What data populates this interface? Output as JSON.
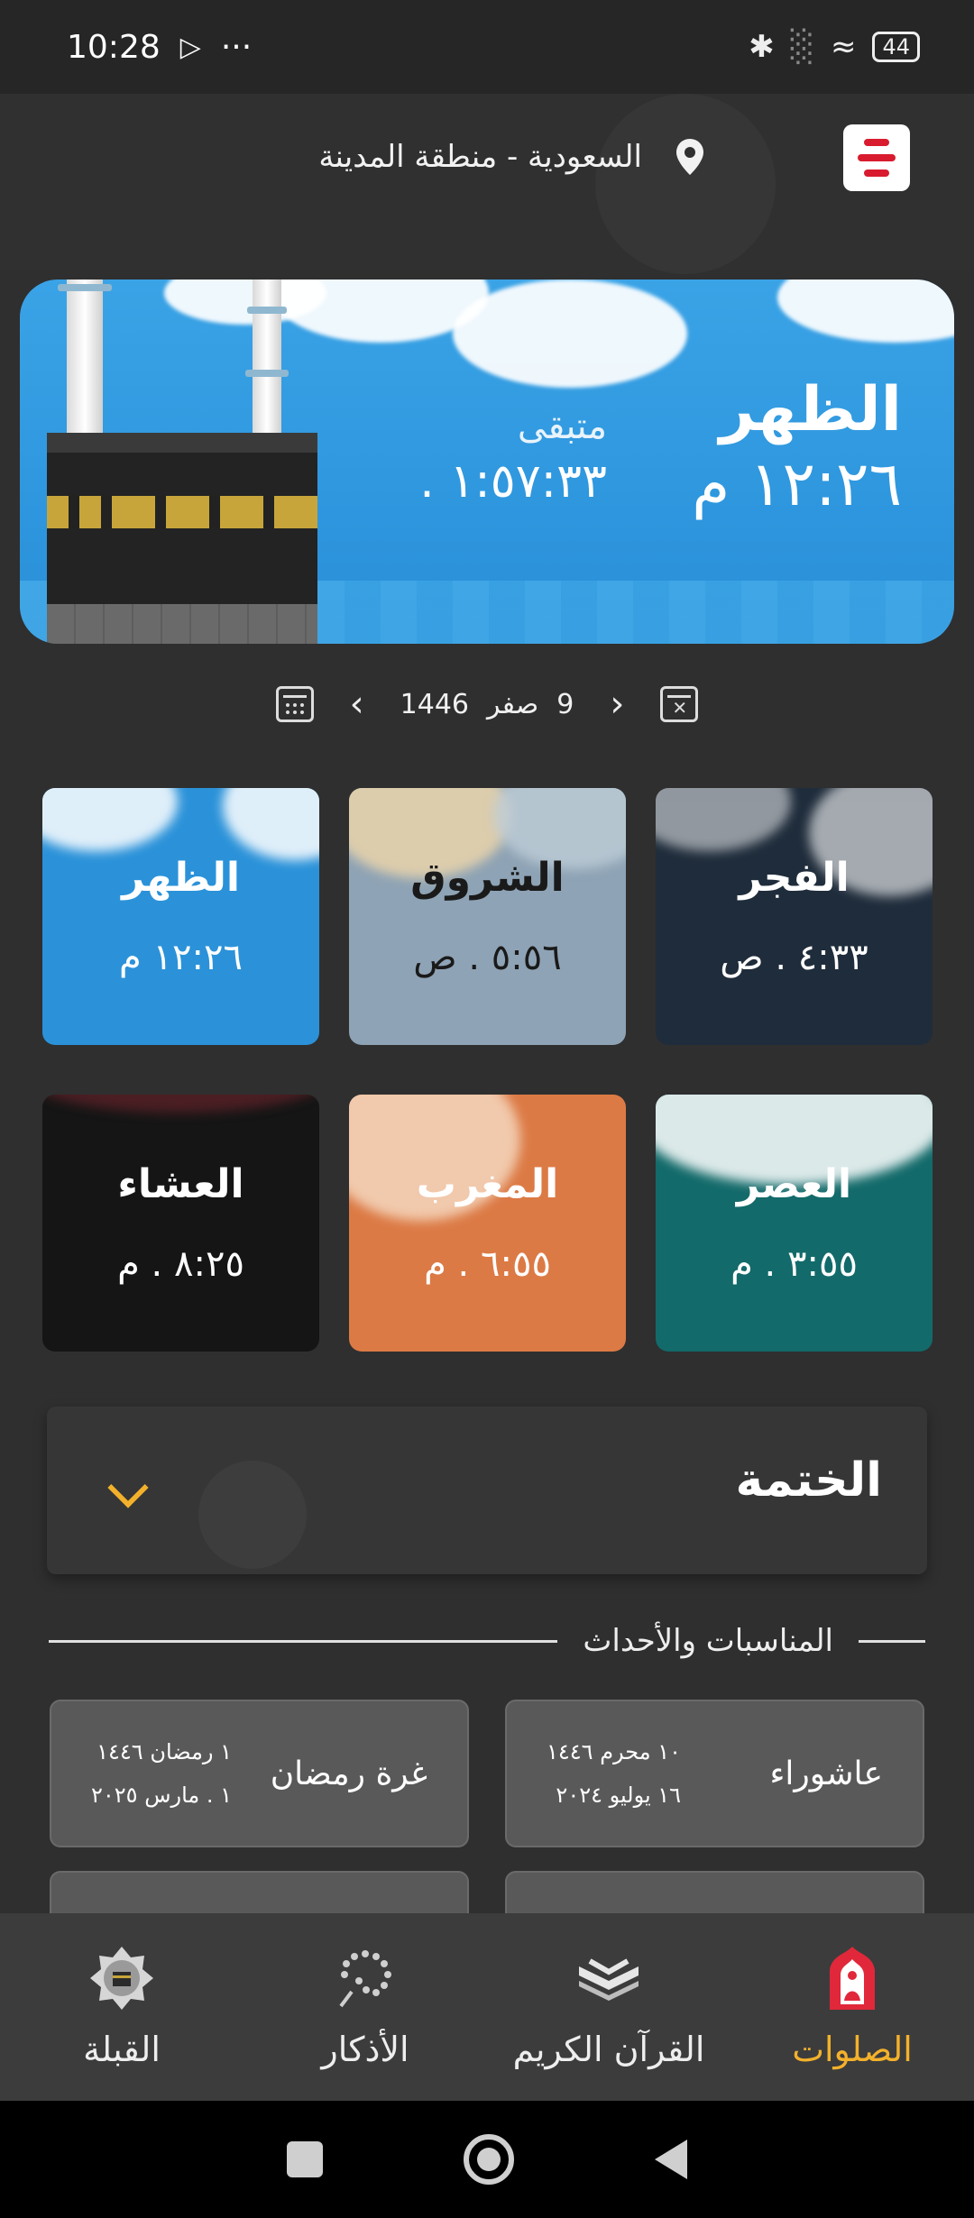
{
  "status_bar": {
    "time": "10:28",
    "more": "···",
    "battery": "44",
    "icons": [
      "play-icon",
      "bluetooth-icon",
      "signal-icon",
      "wifi-icon",
      "battery-icon"
    ]
  },
  "header": {
    "location": "السعودية - منطقة المدينة",
    "menu_icon": "menu-icon",
    "accent_color": "#d81b2e"
  },
  "hero": {
    "prayer_name": "الظهر",
    "prayer_time": "١٢:٢٦ م",
    "remaining_label": "متبقى",
    "remaining_time": "١:٥٧:٣٣ ."
  },
  "date_bar": {
    "day": "9",
    "month": "صفر",
    "year": "1446"
  },
  "prayers": [
    {
      "name": "الفجر",
      "time": "٤:٣٣ . ص",
      "bg": "#1f2c3b"
    },
    {
      "name": "الشروق",
      "time": "٥:٥٦ . ص",
      "bg": "#8ea3b5"
    },
    {
      "name": "الظهر",
      "time": "١٢:٢٦ م",
      "bg": "#2b92d9"
    },
    {
      "name": "العصر",
      "time": "٣:٥٥ . م",
      "bg": "#136a6a"
    },
    {
      "name": "المغرب",
      "time": "٦:٥٥ . م",
      "bg": "#dc7a45"
    },
    {
      "name": "العشاء",
      "time": "٨:٢٥ . م",
      "bg": "#151515"
    }
  ],
  "khatma": {
    "title": "الختمة"
  },
  "events": {
    "header": "المناسبات والأحداث",
    "items": [
      {
        "name": "عاشوراء",
        "hijri": "١٠ محرم ١٤٤٦",
        "gregorian": "١٦ يوليو ٢٠٢٤"
      },
      {
        "name": "غرة رمضان",
        "hijri": "١ رمضان ١٤٤٦",
        "gregorian": "١ . مارس ٢٠٢٥"
      }
    ]
  },
  "bottom_nav": {
    "items": [
      {
        "label": "الصلوات",
        "icon": "mosque-prayer-icon",
        "active": true
      },
      {
        "label": "القرآن الكريم",
        "icon": "quran-icon",
        "active": false
      },
      {
        "label": "الأذكار",
        "icon": "tasbih-icon",
        "active": false
      },
      {
        "label": "القبلة",
        "icon": "qibla-compass-icon",
        "active": false
      }
    ],
    "active_color": "#f3b12b"
  }
}
